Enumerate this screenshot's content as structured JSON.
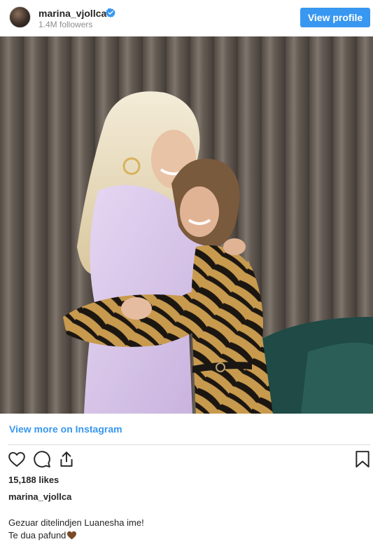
{
  "header": {
    "username": "marina_vjollca",
    "followers": "1.4M followers",
    "view_profile_label": "View profile",
    "verified_icon": "verified-badge-icon"
  },
  "post": {
    "photo_alt": "Two women embracing in front of a curtain",
    "view_more_label": "View more on Instagram",
    "actions": [
      "heart-icon",
      "comment-icon",
      "share-icon",
      "bookmark-icon"
    ],
    "likes": "15,188 likes",
    "caption_username": "marina_vjollca",
    "caption_line1": "Gezuar ditelindjen Luanesha ime!",
    "caption_line2": "Te dua pafund",
    "caption_emoji": "brown-heart-icon"
  },
  "colors": {
    "accent": "#3897f0",
    "text": "#262626",
    "muted": "#8e8e8e",
    "divider": "#dbdbdb",
    "brown_heart": "#7a4b2a"
  }
}
